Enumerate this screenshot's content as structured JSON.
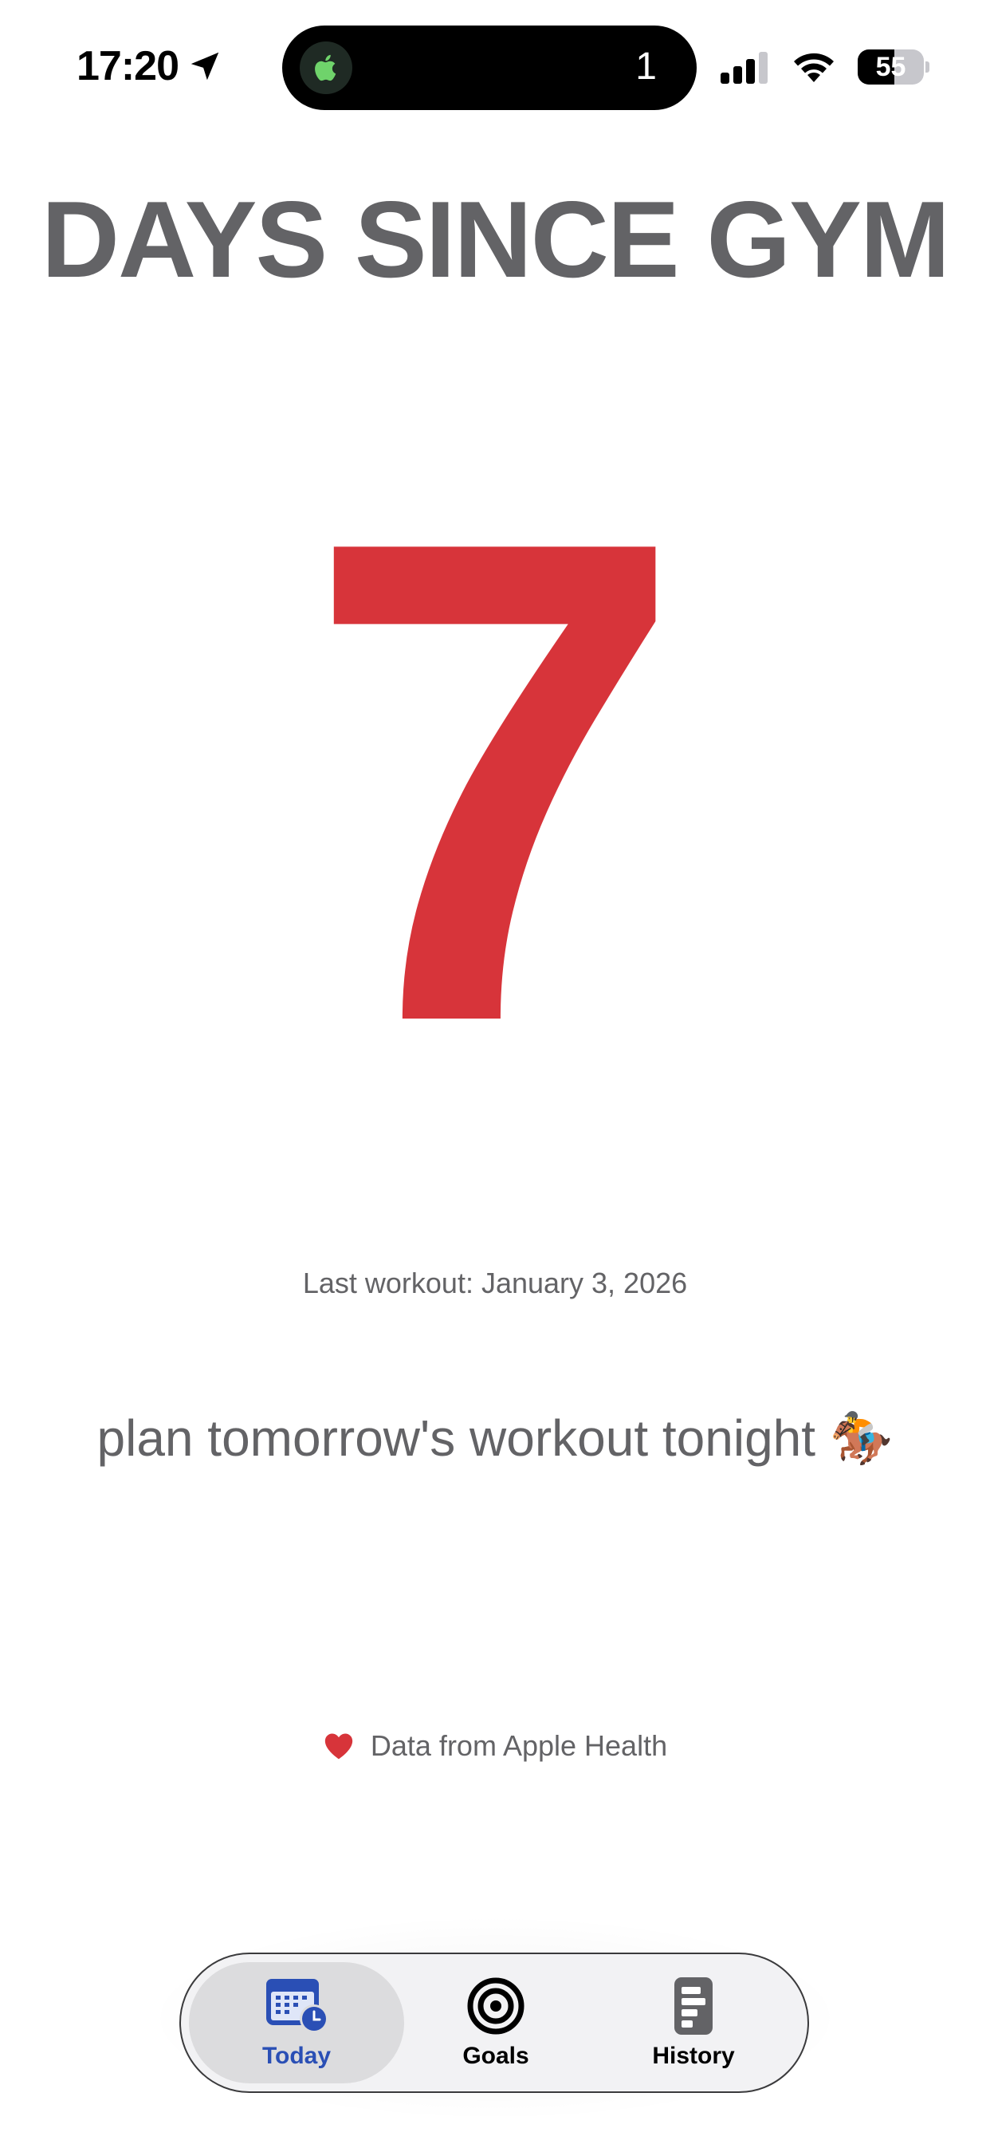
{
  "status_bar": {
    "time": "17:20",
    "island_count": "1",
    "battery_percent": "55",
    "battery_level": 0.55
  },
  "main": {
    "title": "DAYS SINCE GYM",
    "days_count": "7",
    "last_workout": "Last workout: January 3, 2026",
    "motivation": "plan tomorrow's workout tonight 🏇",
    "data_source": "Data from Apple Health"
  },
  "tab_bar": {
    "tabs": [
      {
        "label": "Today",
        "icon": "calendar-clock-icon",
        "active": true
      },
      {
        "label": "Goals",
        "icon": "target-icon",
        "active": false
      },
      {
        "label": "History",
        "icon": "list-document-icon",
        "active": false
      }
    ]
  },
  "colors": {
    "accent_red": "#d7343a",
    "text_gray": "#636366",
    "active_blue": "#2a4fb5"
  }
}
